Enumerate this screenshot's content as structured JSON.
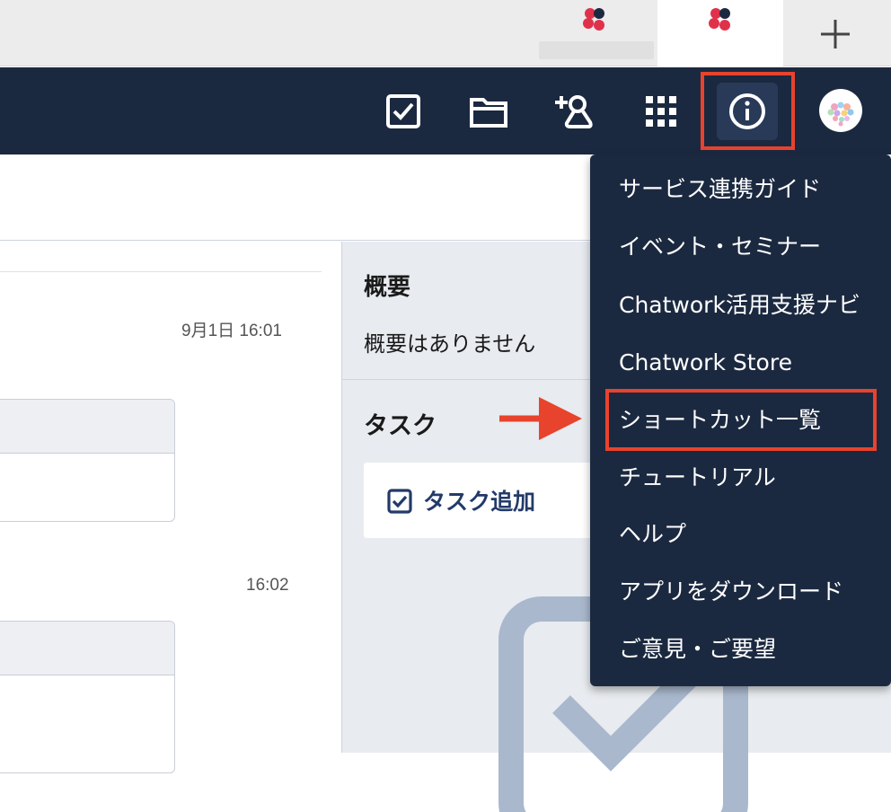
{
  "browser": {
    "tabs": [
      {
        "favicon": "chatwork-flower-icon",
        "active": false
      },
      {
        "favicon": "chatwork-flower-icon",
        "active": true
      }
    ],
    "new_tab_icon": "plus-icon"
  },
  "header": {
    "icons": [
      "task-check-icon",
      "folder-icon",
      "add-contact-icon",
      "apps-grid-icon",
      "info-icon"
    ],
    "avatar": "user-avatar"
  },
  "chat": {
    "timestamps": [
      "9月1日 16:01",
      "16:02"
    ]
  },
  "right_panel": {
    "overview_title": "概要",
    "overview_text": "概要はありません",
    "task_title": "タスク",
    "task_add_label": "タスク追加"
  },
  "info_menu": {
    "items": [
      "サービス連携ガイド",
      "イベント・セミナー",
      "Chatwork活用支援ナビ",
      "Chatwork Store",
      "ショートカット一覧",
      "チュートリアル",
      "ヘルプ",
      "アプリをダウンロード",
      "ご意見・ご要望"
    ],
    "highlighted_index": 4
  },
  "colors": {
    "header_bg": "#1b2940",
    "highlight": "#e8432d",
    "panel_bg": "#e8ebef",
    "task_accent": "#233a69"
  }
}
